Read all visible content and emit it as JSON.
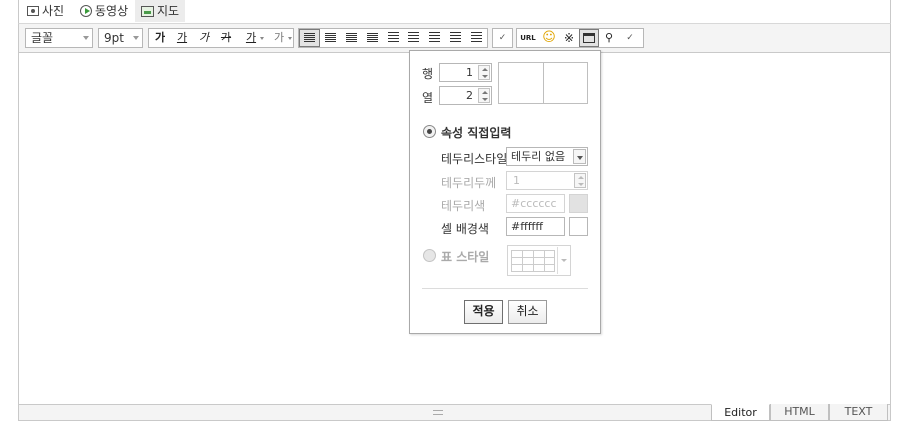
{
  "attach": {
    "items": [
      {
        "label": "사진",
        "icon": "photo-icon"
      },
      {
        "label": "동영상",
        "icon": "video-icon"
      },
      {
        "label": "지도",
        "icon": "map-icon"
      }
    ]
  },
  "toolbar": {
    "font": "글꼴",
    "size": "9pt",
    "bold": "가",
    "underline": "가",
    "italic": "가",
    "strike": "가",
    "color": "가",
    "background": "가",
    "url": "URL"
  },
  "popup": {
    "rows_label": "행",
    "rows_value": "1",
    "cols_label": "열",
    "cols_value": "2",
    "direct_label": "속성 직접입력",
    "border_style_label": "테두리스타일",
    "border_style_value": "테두리 없음",
    "border_width_label": "테두리두께",
    "border_width_value": "1",
    "border_color_label": "테두리색",
    "border_color_value": "#cccccc",
    "cell_bg_label": "셀 배경색",
    "cell_bg_value": "#ffffff",
    "table_style_label": "표 스타일",
    "apply": "적용",
    "cancel": "취소"
  },
  "modes": {
    "editor": "Editor",
    "html": "HTML",
    "text": "TEXT"
  },
  "colors": {
    "border_color_swatch": "#e2e2e2",
    "cell_bg_swatch": "#ffffff"
  }
}
